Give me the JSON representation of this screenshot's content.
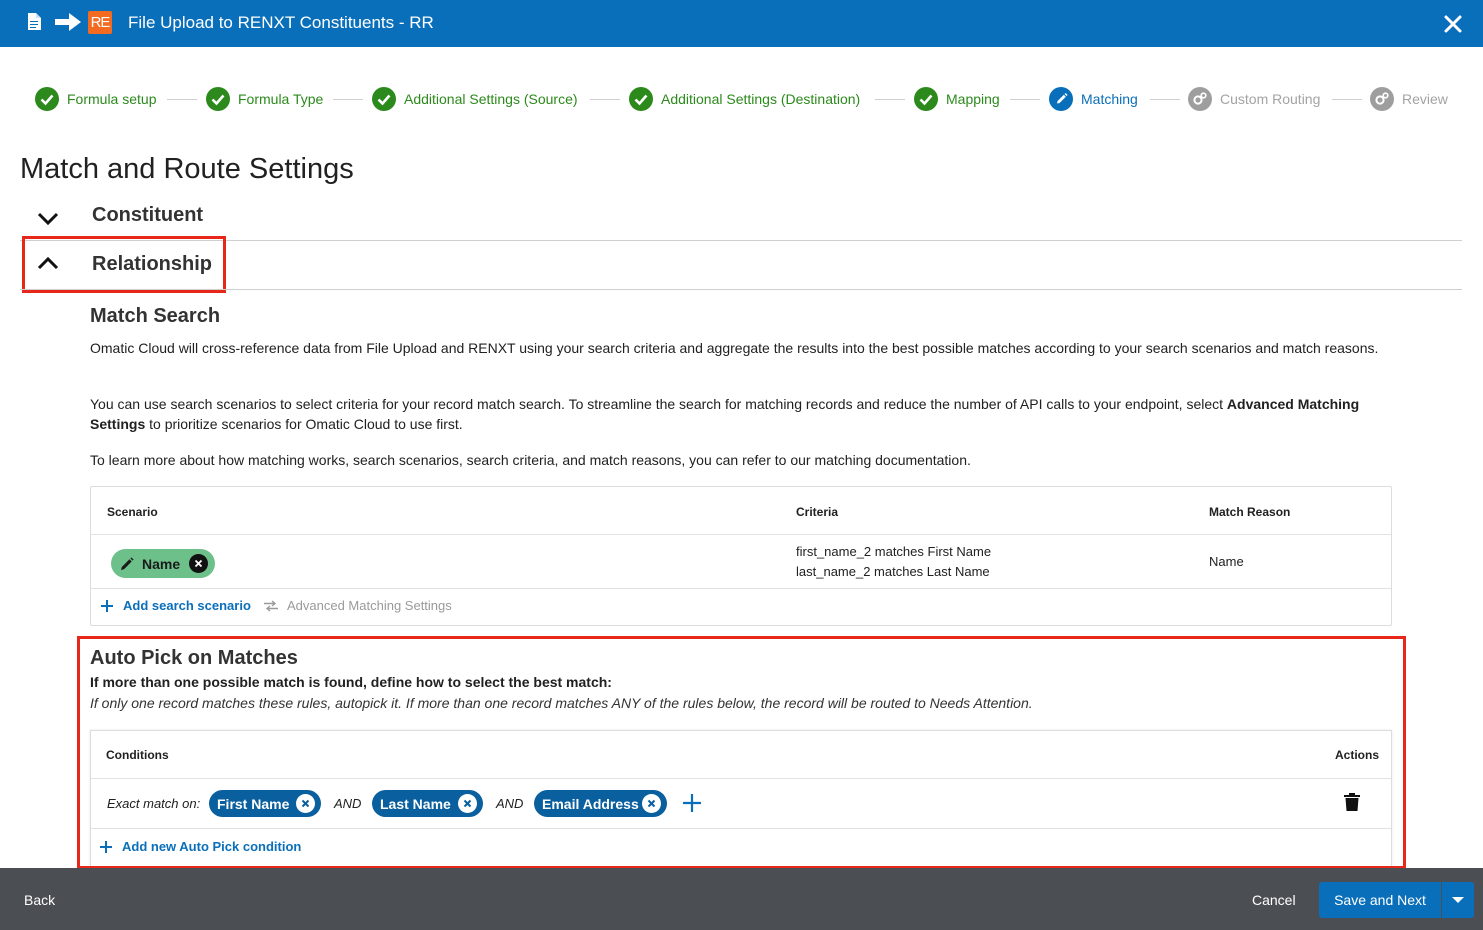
{
  "window": {
    "title": "File Upload to RENXT Constituents - RR",
    "badge": "RE"
  },
  "stepper": {
    "steps": [
      {
        "label": "Formula setup",
        "state": "done"
      },
      {
        "label": "Formula Type",
        "state": "done"
      },
      {
        "label": "Additional Settings (Source)",
        "state": "done"
      },
      {
        "label": "Additional Settings (Destination)",
        "state": "done"
      },
      {
        "label": "Mapping",
        "state": "done"
      },
      {
        "label": "Matching",
        "state": "active"
      },
      {
        "label": "Custom Routing",
        "state": "todo"
      },
      {
        "label": "Review",
        "state": "todo"
      }
    ]
  },
  "page": {
    "title": "Match and Route Settings"
  },
  "sections": {
    "constituent": "Constituent",
    "relationship": "Relationship"
  },
  "match_search": {
    "heading": "Match Search",
    "p1": "Omatic Cloud will cross-reference data from File Upload and RENXT using your search criteria and aggregate the results into the best possible matches according to your search scenarios and match reasons.",
    "p2_before": "You can use search scenarios to select criteria for your record match search. To streamline the search for matching records and reduce the number of API calls to your endpoint, select ",
    "p2_bold": "Advanced Matching Settings",
    "p2_after": " to prioritize scenarios for Omatic Cloud to use first.",
    "p3": "To learn more about how matching works, search scenarios, search criteria, and match reasons, you can refer to our matching documentation."
  },
  "scenario_table": {
    "headers": {
      "scenario": "Scenario",
      "criteria": "Criteria",
      "match_reason": "Match Reason"
    },
    "rows": [
      {
        "scenario": "Name",
        "criteria_1": "first_name_2 matches First Name",
        "criteria_2": "last_name_2 matches Last Name",
        "match_reason": "Name"
      }
    ],
    "add_label": "Add search scenario",
    "advanced_label": "Advanced Matching Settings"
  },
  "auto_pick": {
    "heading": "Auto Pick on Matches",
    "subheading": "If more than one possible match is found, define how to select the best match:",
    "note": "If only one record matches these rules, autopick it. If more than one record matches ANY of the rules below, the record will be routed to Needs Attention.",
    "headers": {
      "conditions": "Conditions",
      "actions": "Actions"
    },
    "row": {
      "prefix": "Exact match on:",
      "fields": [
        "First Name",
        "Last Name",
        "Email Address"
      ],
      "joiner": "AND"
    },
    "add_label": "Add new Auto Pick condition"
  },
  "footer": {
    "back": "Back",
    "cancel": "Cancel",
    "save": "Save and Next"
  },
  "colors": {
    "brand_blue": "#0a6fba",
    "done_green": "#2c8a1c",
    "highlight_red": "#e8271b",
    "chip_green": "#6ec08a",
    "pill_blue": "#0a5f9e",
    "footer_gray": "#4b4f54"
  }
}
